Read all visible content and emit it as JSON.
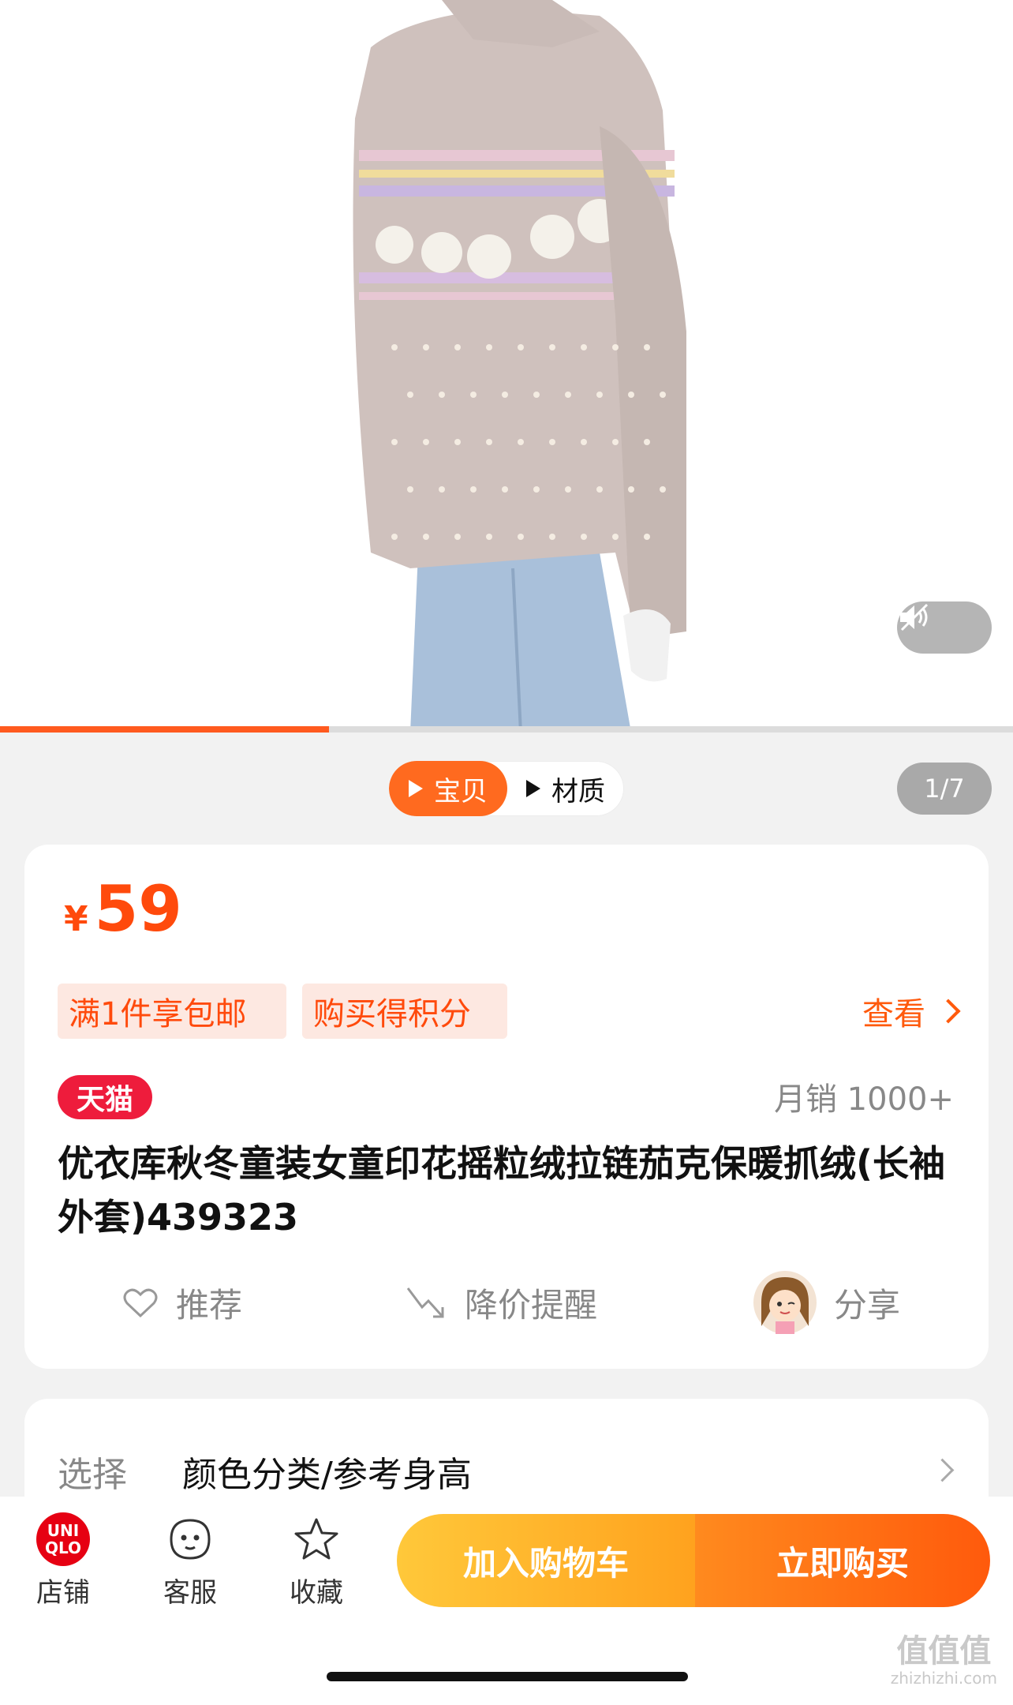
{
  "media": {
    "tabs": [
      {
        "label": "宝贝",
        "active": true
      },
      {
        "label": "材质",
        "active": false
      }
    ],
    "page_counter": "1/7",
    "video_progress": 0.325
  },
  "product": {
    "currency_symbol": "¥",
    "price": "59",
    "promos": [
      "满1件享包邮",
      "购买得积分"
    ],
    "view_link": "查看",
    "store_badge": "天猫",
    "monthly_sales": "月销 1000+",
    "title": "优衣库秋冬童装女童印花摇粒绒拉链茄克保暖抓绒(长袖外套)439323",
    "actions": {
      "recommend": "推荐",
      "price_alert": "降价提醒",
      "share": "分享"
    }
  },
  "options": {
    "label": "选择",
    "value": "颜色分类/参考身高"
  },
  "bottom_bar": {
    "store_logo_line1": "UNI",
    "store_logo_line2": "QLO",
    "store": "店铺",
    "service": "客服",
    "favorite": "收藏",
    "add_to_cart": "加入购物车",
    "buy_now": "立即购买"
  },
  "watermark": {
    "main": "值值值",
    "sub": "zhizhizhi.com"
  },
  "colors": {
    "accent": "#ff5a0c",
    "tmall_red": "#ee1c3c",
    "cart_gradient": [
      "#ffc83a",
      "#ffa21e"
    ],
    "buy_gradient": [
      "#ff8a1e",
      "#ff5a0c"
    ]
  },
  "icons": [
    "volume-muted-icon",
    "play-icon",
    "chevron-right-icon",
    "heart-icon",
    "price-down-arrow-icon",
    "share-avatar-icon",
    "service-chat-icon",
    "star-icon"
  ]
}
